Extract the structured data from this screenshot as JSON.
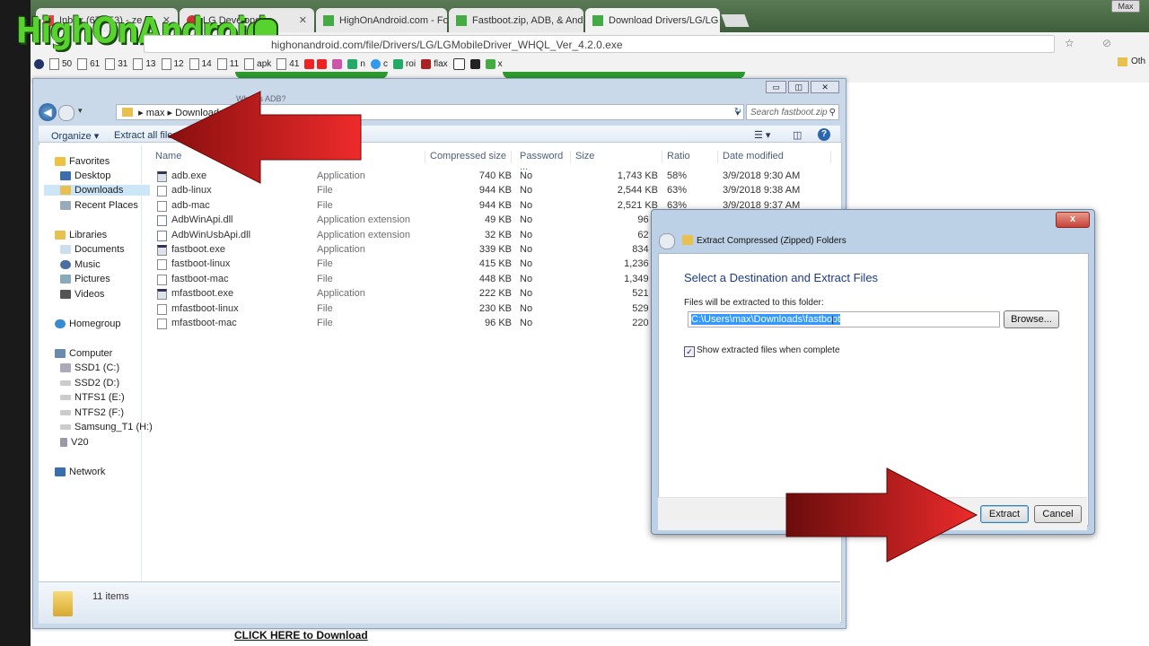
{
  "browser": {
    "tabs": [
      {
        "label": "Inbox (67,853) - ze"
      },
      {
        "label": "LG Developer"
      },
      {
        "label": "HighOnAndroid.com - Fo"
      },
      {
        "label": "Fastboot.zip, ADB, & And"
      },
      {
        "label": "Download Drivers/LG/LG"
      }
    ],
    "logo": "HighOnAndroid",
    "url": "highonandroid.com/file/Drivers/LG/LGMobileDriver_WHQL_Ver_4.2.0.exe",
    "bookmarks": [
      "50",
      "61",
      "31",
      "13",
      "12",
      "14",
      "11",
      "apk",
      "41",
      "n",
      "c",
      "roi",
      "flax",
      "x"
    ],
    "other_bookmarks": "Oth",
    "top_right_button": "Max"
  },
  "page": {
    "behind_text": "What is ADB?",
    "download_link": "CLICK HERE to Download"
  },
  "explorer": {
    "breadcrumb": [
      "max",
      "Downloads",
      "fastb"
    ],
    "search_placeholder": "Search fastboot.zip",
    "organize_label": "Organize ▾",
    "extract_all_label": "Extract all files",
    "nav": {
      "favorites": "Favorites",
      "desktop": "Desktop",
      "downloads": "Downloads",
      "recent": "Recent Places",
      "libraries": "Libraries",
      "documents": "Documents",
      "music": "Music",
      "pictures": "Pictures",
      "videos": "Videos",
      "homegroup": "Homegroup",
      "computer": "Computer",
      "ssd1": "SSD1 (C:)",
      "ssd2": "SSD2 (D:)",
      "ntfs1": "NTFS1 (E:)",
      "ntfs2": "NTFS2 (F:)",
      "samsung": "Samsung_T1 (H:)",
      "v20": "V20",
      "network": "Network"
    },
    "columns": {
      "name": "Name",
      "type": "Type",
      "compressed": "Compressed size",
      "password": "Password ...",
      "size": "Size",
      "ratio": "Ratio",
      "date": "Date modified"
    },
    "files": [
      {
        "name": "adb.exe",
        "type": "Application",
        "compressed": "740 KB",
        "password": "No",
        "size": "1,743 KB",
        "ratio": "58%",
        "date": "3/9/2018 9:30 AM",
        "icon": "app"
      },
      {
        "name": "adb-linux",
        "type": "File",
        "compressed": "944 KB",
        "password": "No",
        "size": "2,544 KB",
        "ratio": "63%",
        "date": "3/9/2018 9:38 AM",
        "icon": "file"
      },
      {
        "name": "adb-mac",
        "type": "File",
        "compressed": "944 KB",
        "password": "No",
        "size": "2,521 KB",
        "ratio": "63%",
        "date": "3/9/2018 9:37 AM",
        "icon": "file"
      },
      {
        "name": "AdbWinApi.dll",
        "type": "Application extension",
        "compressed": "49 KB",
        "password": "No",
        "size": "96 K",
        "ratio": "",
        "date": "",
        "icon": "dll"
      },
      {
        "name": "AdbWinUsbApi.dll",
        "type": "Application extension",
        "compressed": "32 KB",
        "password": "No",
        "size": "62 K",
        "ratio": "",
        "date": "",
        "icon": "dll"
      },
      {
        "name": "fastboot.exe",
        "type": "Application",
        "compressed": "339 KB",
        "password": "No",
        "size": "834 K",
        "ratio": "",
        "date": "",
        "icon": "app"
      },
      {
        "name": "fastboot-linux",
        "type": "File",
        "compressed": "415 KB",
        "password": "No",
        "size": "1,236 K",
        "ratio": "",
        "date": "",
        "icon": "file"
      },
      {
        "name": "fastboot-mac",
        "type": "File",
        "compressed": "448 KB",
        "password": "No",
        "size": "1,349 K",
        "ratio": "",
        "date": "",
        "icon": "file"
      },
      {
        "name": "mfastboot.exe",
        "type": "Application",
        "compressed": "222 KB",
        "password": "No",
        "size": "521 K",
        "ratio": "",
        "date": "",
        "icon": "app"
      },
      {
        "name": "mfastboot-linux",
        "type": "File",
        "compressed": "230 KB",
        "password": "No",
        "size": "529 K",
        "ratio": "",
        "date": "",
        "icon": "file"
      },
      {
        "name": "mfastboot-mac",
        "type": "File",
        "compressed": "96 KB",
        "password": "No",
        "size": "220 K",
        "ratio": "",
        "date": "",
        "icon": "file"
      }
    ],
    "item_count": "11 items"
  },
  "dialog": {
    "title": "Extract Compressed (Zipped) Folders",
    "heading": "Select a Destination and Extract Files",
    "folder_label": "Files will be extracted to this folder:",
    "path": "C:\\Users\\max\\Downloads\\fastboot",
    "browse_label": "Browse...",
    "show_files_label": "Show extracted files when complete",
    "show_files_checked": true,
    "extract_label": "Extract",
    "cancel_label": "Cancel",
    "close_label": "x"
  },
  "colors": {
    "arrow_red": "#e02020",
    "logo_green": "#58d22f",
    "selection_blue": "#3399ff"
  }
}
